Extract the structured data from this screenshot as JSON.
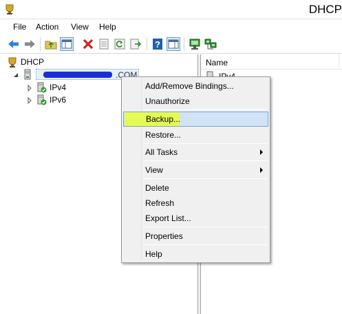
{
  "window": {
    "title": "DHCP"
  },
  "menubar": {
    "items": [
      "File",
      "Action",
      "View",
      "Help"
    ]
  },
  "toolbar": {
    "buttons": [
      "back-icon",
      "forward-icon",
      "up-folder-icon",
      "show-hide-tree-icon",
      "delete-icon",
      "properties-sheet-icon",
      "refresh-icon",
      "export-list-icon",
      "help-icon",
      "show-action-pane-icon",
      "server-status-icon",
      "network-server-icon"
    ]
  },
  "tree": {
    "root": "DHCP",
    "server_visible_suffix": ".COM",
    "children": [
      "IPv4",
      "IPv6"
    ]
  },
  "list": {
    "column_name": "Name",
    "first_row": "IPv4"
  },
  "context_menu": {
    "items": [
      {
        "label": "Add/Remove Bindings..."
      },
      {
        "label": "Unauthorize"
      },
      {
        "label": "Backup..."
      },
      {
        "label": "Restore..."
      },
      {
        "label": "All Tasks"
      },
      {
        "label": "View"
      },
      {
        "label": "Delete"
      },
      {
        "label": "Refresh"
      },
      {
        "label": "Export List..."
      },
      {
        "label": "Properties"
      },
      {
        "label": "Help"
      }
    ],
    "highlighted": "Backup...",
    "highlight_color": "#e8ff3a",
    "selection_color": "#d1e3f7"
  }
}
